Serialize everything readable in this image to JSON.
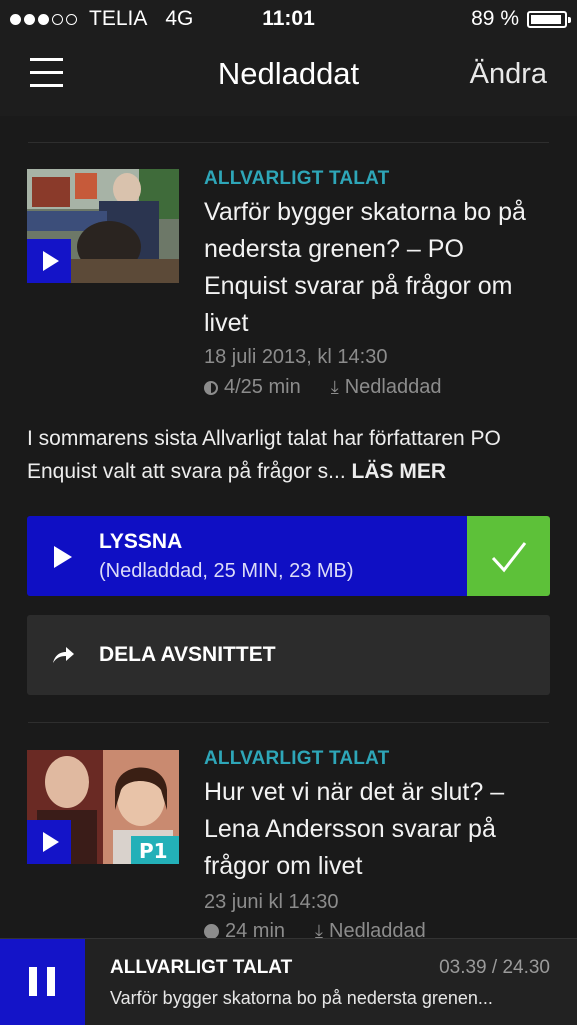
{
  "status_bar": {
    "carrier": "TELIA",
    "network": "4G",
    "time": "11:01",
    "battery": "89 %",
    "signal_bars_filled": 3,
    "signal_bars_total": 5
  },
  "nav": {
    "title": "Nedladdat",
    "edit_label": "Ändra",
    "menu_icon": "hamburger-menu-icon"
  },
  "episodes": [
    {
      "program": "ALLVARLIGT TALAT",
      "title": "Varför bygger skatorna bo på nedersta grenen? – PO Enquist svarar på frågor om livet",
      "date": "18 juli 2013, kl 14:30",
      "progress": "4/25 min",
      "download_status": "Nedladdad",
      "description": "I sommarens sista Allvarligt talat har författaren PO Enquist valt att svara på frågor s...",
      "read_more": "LÄS MER",
      "listen_label": "LYSSNA",
      "listen_detail": "(Nedladdad, 25 MIN, 23 MB)",
      "share_label": "DELA AVSNITTET"
    },
    {
      "program": "ALLVARLIGT TALAT",
      "title": "Hur vet vi när det är slut? – Lena Andersson svarar på frågor om livet",
      "date": "23 juni kl 14:30",
      "duration": "24 min",
      "download_status": "Nedladdad",
      "channel_badge": "P1"
    }
  ],
  "player": {
    "program": "ALLVARLIGT TALAT",
    "time": "03.39 / 24.30",
    "episode": "Varför bygger skatorna bo på nedersta grenen..."
  },
  "colors": {
    "accent_blue": "#1414c8",
    "program_teal": "#2ea6b8",
    "check_green": "#5dc139"
  }
}
